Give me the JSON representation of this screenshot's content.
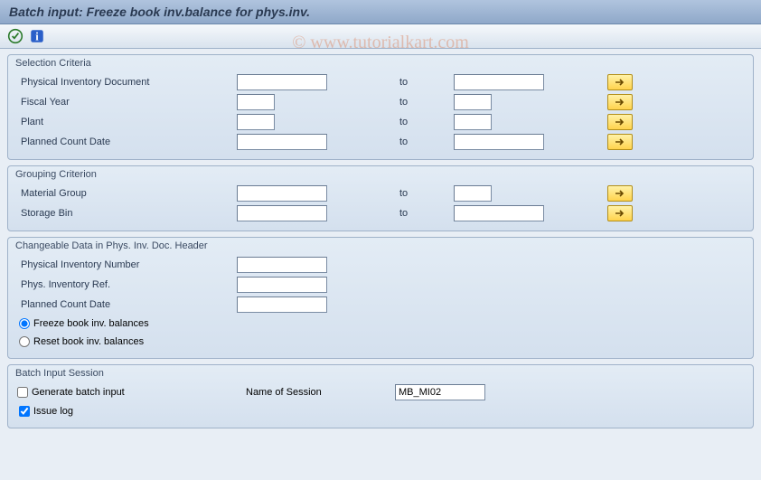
{
  "title": "Batch input: Freeze book inv.balance for phys.inv.",
  "watermark": "© www.tutorialkart.com",
  "selection": {
    "title": "Selection Criteria",
    "to": "to",
    "rows": [
      {
        "label": "Physical Inventory Document",
        "wide": true
      },
      {
        "label": "Fiscal Year",
        "wide": false
      },
      {
        "label": "Plant",
        "wide": false
      },
      {
        "label": "Planned Count Date",
        "wide": true
      }
    ]
  },
  "grouping": {
    "title": "Grouping Criterion",
    "to": "to",
    "rows": [
      {
        "label": "Material Group",
        "wide": false
      },
      {
        "label": "Storage Bin",
        "wide": false
      }
    ]
  },
  "changeable": {
    "title": "Changeable Data in Phys. Inv. Doc. Header",
    "rows": [
      "Physical Inventory Number",
      "Phys. Inventory Ref.",
      "Planned Count Date"
    ],
    "radio1": "Freeze book inv. balances",
    "radio2": "Reset book inv. balances"
  },
  "batch": {
    "title": "Batch Input Session",
    "generate": "Generate batch input",
    "session_label": "Name of Session",
    "session_value": "MB_MI02",
    "issue": "Issue log"
  }
}
